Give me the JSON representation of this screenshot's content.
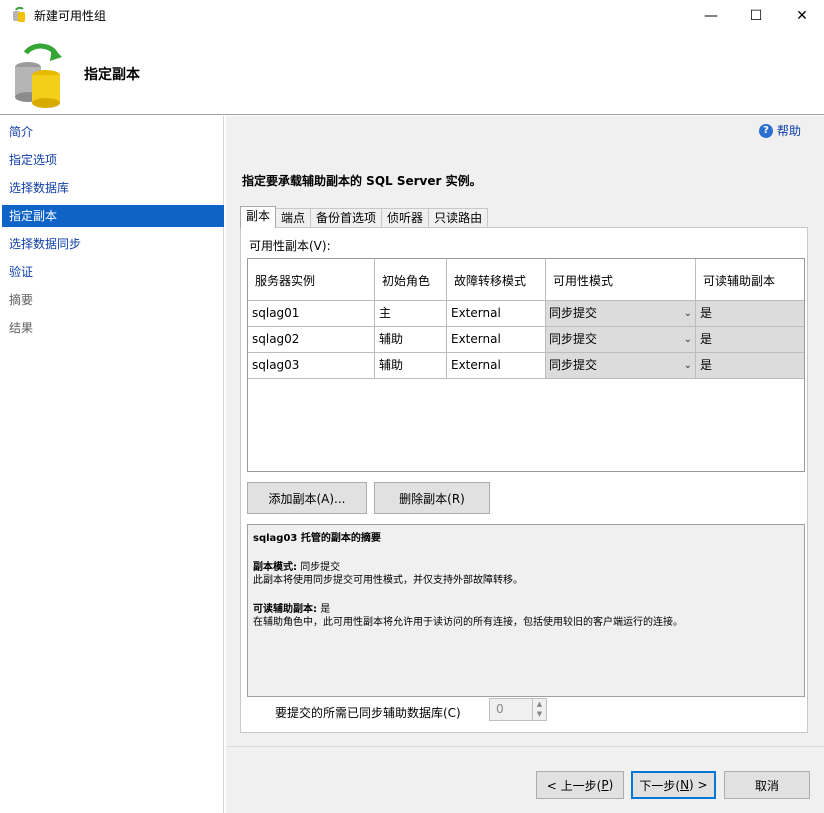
{
  "window": {
    "title": "新建可用性组",
    "minimize_glyph": "—",
    "maximize_glyph": "☐",
    "close_glyph": "✕"
  },
  "header": {
    "title": "指定副本"
  },
  "nav": {
    "items": [
      {
        "label": "简介",
        "state": "link"
      },
      {
        "label": "指定选项",
        "state": "link"
      },
      {
        "label": "选择数据库",
        "state": "link"
      },
      {
        "label": "指定副本",
        "state": "active"
      },
      {
        "label": "选择数据同步",
        "state": "link"
      },
      {
        "label": "验证",
        "state": "link"
      },
      {
        "label": "摘要",
        "state": "disabled"
      },
      {
        "label": "结果",
        "state": "disabled"
      }
    ]
  },
  "help": {
    "label": "帮助",
    "icon": "question-circle-icon",
    "glyph": "?"
  },
  "instruction": "指定要承载辅助副本的 SQL Server 实例。",
  "tabs": [
    "副本",
    "端点",
    "备份首选项",
    "侦听器",
    "只读路由"
  ],
  "replicas": {
    "label": "可用性副本(V):",
    "columns": [
      "服务器实例",
      "初始角色",
      "故障转移模式",
      "可用性模式",
      "可读辅助副本"
    ],
    "rows": [
      {
        "server": "sqlag01",
        "role": "主",
        "failover": "External",
        "mode": "同步提交",
        "readable": "是"
      },
      {
        "server": "sqlag02",
        "role": "辅助",
        "failover": "External",
        "mode": "同步提交",
        "readable": "是"
      },
      {
        "server": "sqlag03",
        "role": "辅助",
        "failover": "External",
        "mode": "同步提交",
        "readable": "是"
      }
    ]
  },
  "buttons": {
    "add_replica": "添加副本(A)...",
    "remove_replica": "删除副本(R)"
  },
  "summary": {
    "title": "sqlag03 托管的副本的摘要",
    "mode_label": "副本模式:",
    "mode_value": "同步提交",
    "mode_desc": "此副本将使用同步提交可用性模式，并仅支持外部故障转移。",
    "readable_label": "可读辅助副本:",
    "readable_value": "是",
    "readable_desc": "在辅助角色中，此可用性副本将允许用于读访问的所有连接，包括使用较旧的客户端运行的连接。"
  },
  "commit": {
    "label": "要提交的所需已同步辅助数据库(C)",
    "value": "0"
  },
  "footer": {
    "prev_prefix": "< 上一步(",
    "prev_key": "P",
    "prev_suffix": ")",
    "next_prefix": "下一步(",
    "next_key": "N",
    "next_suffix": ") >",
    "cancel": "取消"
  },
  "colors": {
    "accent": "#0d63c6",
    "link": "#0d3ea8",
    "panel_bg": "#f0f0f0"
  }
}
